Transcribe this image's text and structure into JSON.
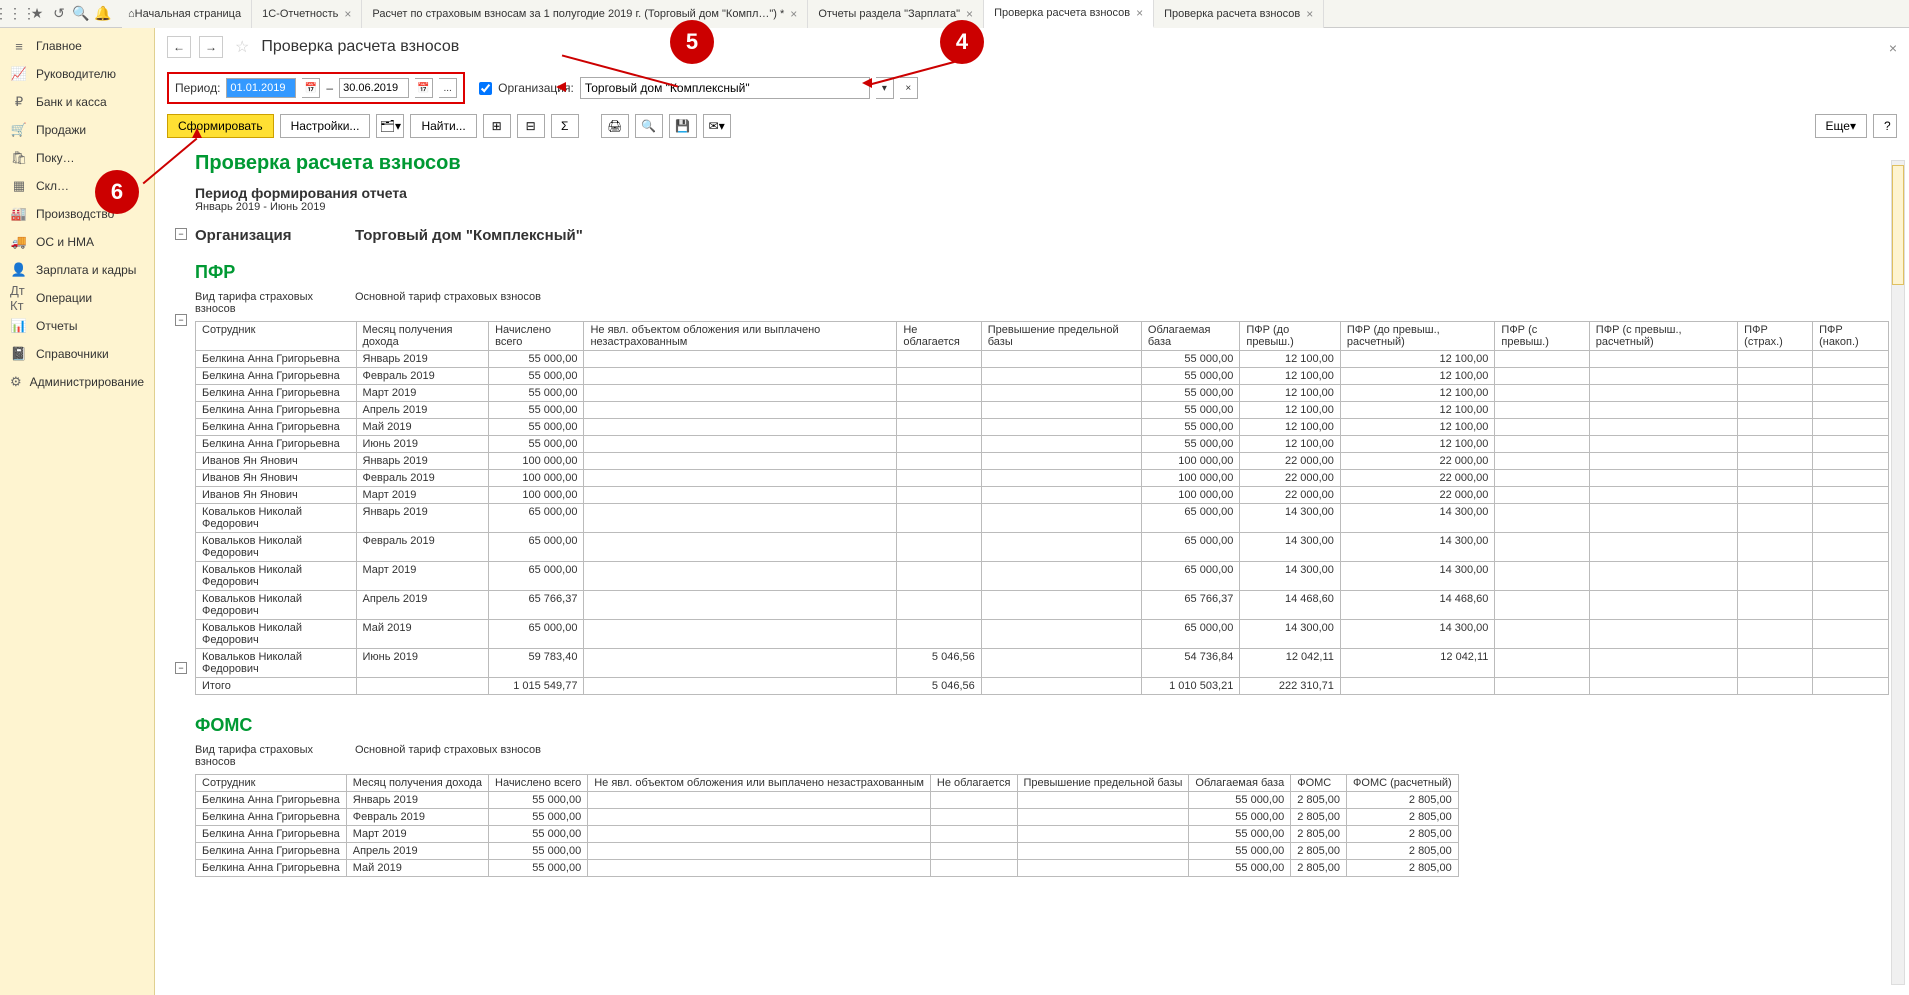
{
  "toolbar_icons": [
    "apps",
    "star",
    "history",
    "search",
    "bell"
  ],
  "tabs": [
    {
      "label": "Начальная страница",
      "home": true
    },
    {
      "label": "1С-Отчетность",
      "close": true
    },
    {
      "label": "Расчет по страховым взносам за 1 полугодие 2019 г. (Торговый дом \"Компл…\") *",
      "close": true
    },
    {
      "label": "Отчеты раздела \"Зарплата\"",
      "close": true
    },
    {
      "label": "Проверка расчета взносов",
      "close": true,
      "active": true
    },
    {
      "label": "Проверка расчета взносов",
      "close": true
    }
  ],
  "sidebar": [
    {
      "icon": "≡",
      "label": "Главное"
    },
    {
      "icon": "📈",
      "label": "Руководителю"
    },
    {
      "icon": "₽",
      "label": "Банк и касса"
    },
    {
      "icon": "🛒",
      "label": "Продажи"
    },
    {
      "icon": "🛍",
      "label": "Поку…"
    },
    {
      "icon": "▦",
      "label": "Скл…"
    },
    {
      "icon": "🏭",
      "label": "Производство"
    },
    {
      "icon": "🚚",
      "label": "ОС и НМА"
    },
    {
      "icon": "👤",
      "label": "Зарплата и кадры"
    },
    {
      "icon": "Дт Кт",
      "label": "Операции"
    },
    {
      "icon": "📊",
      "label": "Отчеты"
    },
    {
      "icon": "📓",
      "label": "Справочники"
    },
    {
      "icon": "⚙",
      "label": "Администрирование"
    }
  ],
  "page_title": "Проверка расчета взносов",
  "filters": {
    "period_label": "Период:",
    "date_from": "01.01.2019",
    "date_to": "30.06.2019",
    "dash": "–",
    "ellipsis": "...",
    "org_label": "Организация:",
    "org_value": "Торговый дом \"Комплексный\""
  },
  "buttons": {
    "generate": "Сформировать",
    "settings": "Настройки...",
    "find": "Найти...",
    "more": "Еще",
    "help": "?"
  },
  "report": {
    "title": "Проверка расчета взносов",
    "period_header": "Период формирования отчета",
    "period_text": "Январь 2019 - Июнь 2019",
    "org_label": "Организация",
    "org_value": "Торговый дом \"Комплексный\"",
    "tariff_label": "Вид тарифа страховых взносов",
    "tariff_value": "Основной тариф страховых взносов",
    "section_pfr": "ПФР",
    "section_foms": "ФОМС",
    "pfr_headers": [
      "Сотрудник",
      "Месяц получения дохода",
      "Начислено всего",
      "Не явл. объектом обложения или выплачено незастрахованным",
      "Не облагается",
      "Превышение предельной базы",
      "Облагаемая база",
      "ПФР (до превыш.)",
      "ПФР (до превыш., расчетный)",
      "ПФР (с превыш.)",
      "ПФР (с превыш., расчетный)",
      "ПФР (страх.)",
      "ПФР (накоп.)"
    ],
    "pfr_rows": [
      {
        "emp": "Белкина Анна Григорьевна",
        "month": "Январь 2019",
        "acc": "55 000,00",
        "base": "55 000,00",
        "pfr1": "12 100,00",
        "pfr2": "12 100,00"
      },
      {
        "emp": "Белкина Анна Григорьевна",
        "month": "Февраль 2019",
        "acc": "55 000,00",
        "base": "55 000,00",
        "pfr1": "12 100,00",
        "pfr2": "12 100,00"
      },
      {
        "emp": "Белкина Анна Григорьевна",
        "month": "Март 2019",
        "acc": "55 000,00",
        "base": "55 000,00",
        "pfr1": "12 100,00",
        "pfr2": "12 100,00"
      },
      {
        "emp": "Белкина Анна Григорьевна",
        "month": "Апрель 2019",
        "acc": "55 000,00",
        "base": "55 000,00",
        "pfr1": "12 100,00",
        "pfr2": "12 100,00"
      },
      {
        "emp": "Белкина Анна Григорьевна",
        "month": "Май 2019",
        "acc": "55 000,00",
        "base": "55 000,00",
        "pfr1": "12 100,00",
        "pfr2": "12 100,00"
      },
      {
        "emp": "Белкина Анна Григорьевна",
        "month": "Июнь 2019",
        "acc": "55 000,00",
        "base": "55 000,00",
        "pfr1": "12 100,00",
        "pfr2": "12 100,00"
      },
      {
        "emp": "Иванов Ян Янович",
        "month": "Январь 2019",
        "acc": "100 000,00",
        "base": "100 000,00",
        "pfr1": "22 000,00",
        "pfr2": "22 000,00"
      },
      {
        "emp": "Иванов Ян Янович",
        "month": "Февраль 2019",
        "acc": "100 000,00",
        "base": "100 000,00",
        "pfr1": "22 000,00",
        "pfr2": "22 000,00"
      },
      {
        "emp": "Иванов Ян Янович",
        "month": "Март 2019",
        "acc": "100 000,00",
        "base": "100 000,00",
        "pfr1": "22 000,00",
        "pfr2": "22 000,00"
      },
      {
        "emp": "Ковальков Николай Федорович",
        "month": "Январь 2019",
        "acc": "65 000,00",
        "base": "65 000,00",
        "pfr1": "14 300,00",
        "pfr2": "14 300,00"
      },
      {
        "emp": "Ковальков Николай Федорович",
        "month": "Февраль 2019",
        "acc": "65 000,00",
        "base": "65 000,00",
        "pfr1": "14 300,00",
        "pfr2": "14 300,00"
      },
      {
        "emp": "Ковальков Николай Федорович",
        "month": "Март 2019",
        "acc": "65 000,00",
        "base": "65 000,00",
        "pfr1": "14 300,00",
        "pfr2": "14 300,00"
      },
      {
        "emp": "Ковальков Николай Федорович",
        "month": "Апрель 2019",
        "acc": "65 766,37",
        "base": "65 766,37",
        "pfr1": "14 468,60",
        "pfr2": "14 468,60"
      },
      {
        "emp": "Ковальков Николай Федорович",
        "month": "Май 2019",
        "acc": "65 000,00",
        "base": "65 000,00",
        "pfr1": "14 300,00",
        "pfr2": "14 300,00"
      },
      {
        "emp": "Ковальков Николай Федорович",
        "month": "Июнь 2019",
        "acc": "59 783,40",
        "notax": "5 046,56",
        "base": "54 736,84",
        "pfr1": "12 042,11",
        "pfr2": "12 042,11"
      }
    ],
    "pfr_total": {
      "emp": "Итого",
      "acc": "1 015 549,77",
      "notax": "5 046,56",
      "base": "1 010 503,21",
      "pfr1": "222 310,71"
    },
    "foms_headers": [
      "Сотрудник",
      "Месяц получения дохода",
      "Начислено всего",
      "Не явл. объектом обложения или выплачено незастрахованным",
      "Не облагается",
      "Превышение предельной базы",
      "Облагаемая база",
      "ФОМС",
      "ФОМС (расчетный)"
    ],
    "foms_rows": [
      {
        "emp": "Белкина Анна Григорьевна",
        "month": "Январь 2019",
        "acc": "55 000,00",
        "base": "55 000,00",
        "f1": "2 805,00",
        "f2": "2 805,00"
      },
      {
        "emp": "Белкина Анна Григорьевна",
        "month": "Февраль 2019",
        "acc": "55 000,00",
        "base": "55 000,00",
        "f1": "2 805,00",
        "f2": "2 805,00"
      },
      {
        "emp": "Белкина Анна Григорьевна",
        "month": "Март 2019",
        "acc": "55 000,00",
        "base": "55 000,00",
        "f1": "2 805,00",
        "f2": "2 805,00"
      },
      {
        "emp": "Белкина Анна Григорьевна",
        "month": "Апрель 2019",
        "acc": "55 000,00",
        "base": "55 000,00",
        "f1": "2 805,00",
        "f2": "2 805,00"
      },
      {
        "emp": "Белкина Анна Григорьевна",
        "month": "Май 2019",
        "acc": "55 000,00",
        "base": "55 000,00",
        "f1": "2 805,00",
        "f2": "2 805,00"
      }
    ]
  },
  "annotations": {
    "a4": "4",
    "a5": "5",
    "a6": "6"
  }
}
